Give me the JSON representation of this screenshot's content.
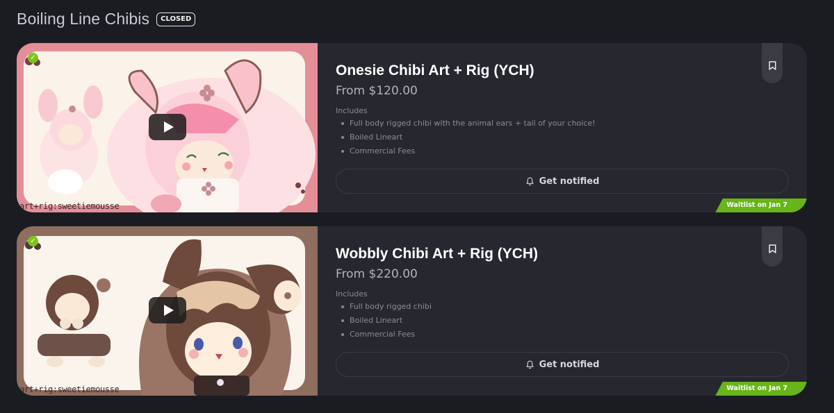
{
  "section": {
    "title": "Boiling Line Chibis",
    "status_badge": "CLOSED"
  },
  "colors": {
    "accent_green": "#67b51a",
    "card_bg": "#26272f",
    "page_bg": "#1b1c22"
  },
  "cards": [
    {
      "title": "Onesie Chibi Art + Rig (YCH)",
      "price": "From $120.00",
      "includes_label": "Includes",
      "includes": [
        "Full body rigged chibi with the animal ears + tail of your choice!",
        "Boiled Lineart",
        "Commercial Fees"
      ],
      "notify_label": "Get notified",
      "waitlist_label": "Waitlist on Jan 7",
      "thumbnail_watermark": "art+rig:sweetiemousse",
      "thumbnail_theme": "pink",
      "icons": [
        "play-icon",
        "verified-icon",
        "bell-icon",
        "bookmark-icon"
      ]
    },
    {
      "title": "Wobbly Chibi Art + Rig (YCH)",
      "price": "From $220.00",
      "includes_label": "Includes",
      "includes": [
        "Full body rigged chibi",
        "Boiled Lineart",
        "Commercial Fees"
      ],
      "notify_label": "Get notified",
      "waitlist_label": "Waitlist on Jan 7",
      "thumbnail_watermark": "art+rig:sweetiemousse",
      "thumbnail_theme": "brown",
      "icons": [
        "play-icon",
        "verified-icon",
        "bell-icon",
        "bookmark-icon"
      ]
    }
  ]
}
